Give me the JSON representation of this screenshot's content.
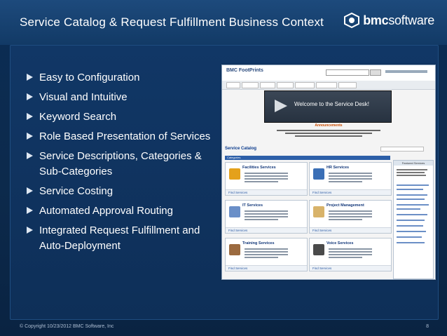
{
  "slide": {
    "title": "Service Catalog & Request Fulfillment Business Context",
    "logo": {
      "prefix": "bmc",
      "suffix": "software"
    },
    "bullets": [
      "Easy to Configuration",
      "Visual and Intuitive",
      "Keyword Search",
      "Role Based Presentation of Services",
      "Service Descriptions, Categories & Sub-Categories",
      "Service Costing",
      "Automated Approval Routing",
      "Integrated Request Fulfillment and Auto-Deployment"
    ],
    "footer_left": "© Copyright 10/23/2012 BMC Software, Inc",
    "footer_right": "8"
  },
  "screenshot": {
    "app_name": "BMC FootPrints",
    "banner": "Welcome to the Service Desk!",
    "announcements": "Announcements",
    "catalog_title": "Service Catalog",
    "category_bar": "Categories",
    "featured_title": "Featured Services",
    "cards": [
      {
        "title": "Facilities Services",
        "link": "Find Services"
      },
      {
        "title": "HR Services",
        "link": "Find Services"
      },
      {
        "title": "IT Services",
        "link": "Find Services"
      },
      {
        "title": "Project Management",
        "link": "Find Services"
      },
      {
        "title": "Training Services",
        "link": "Find Services"
      },
      {
        "title": "Voice Services",
        "link": "Find Services"
      }
    ]
  },
  "colors": {
    "background": "#0c2a4c",
    "title_bar": "#1d4a7c",
    "bullet_text": "#ffffff",
    "link_blue": "#2b5aa3"
  }
}
